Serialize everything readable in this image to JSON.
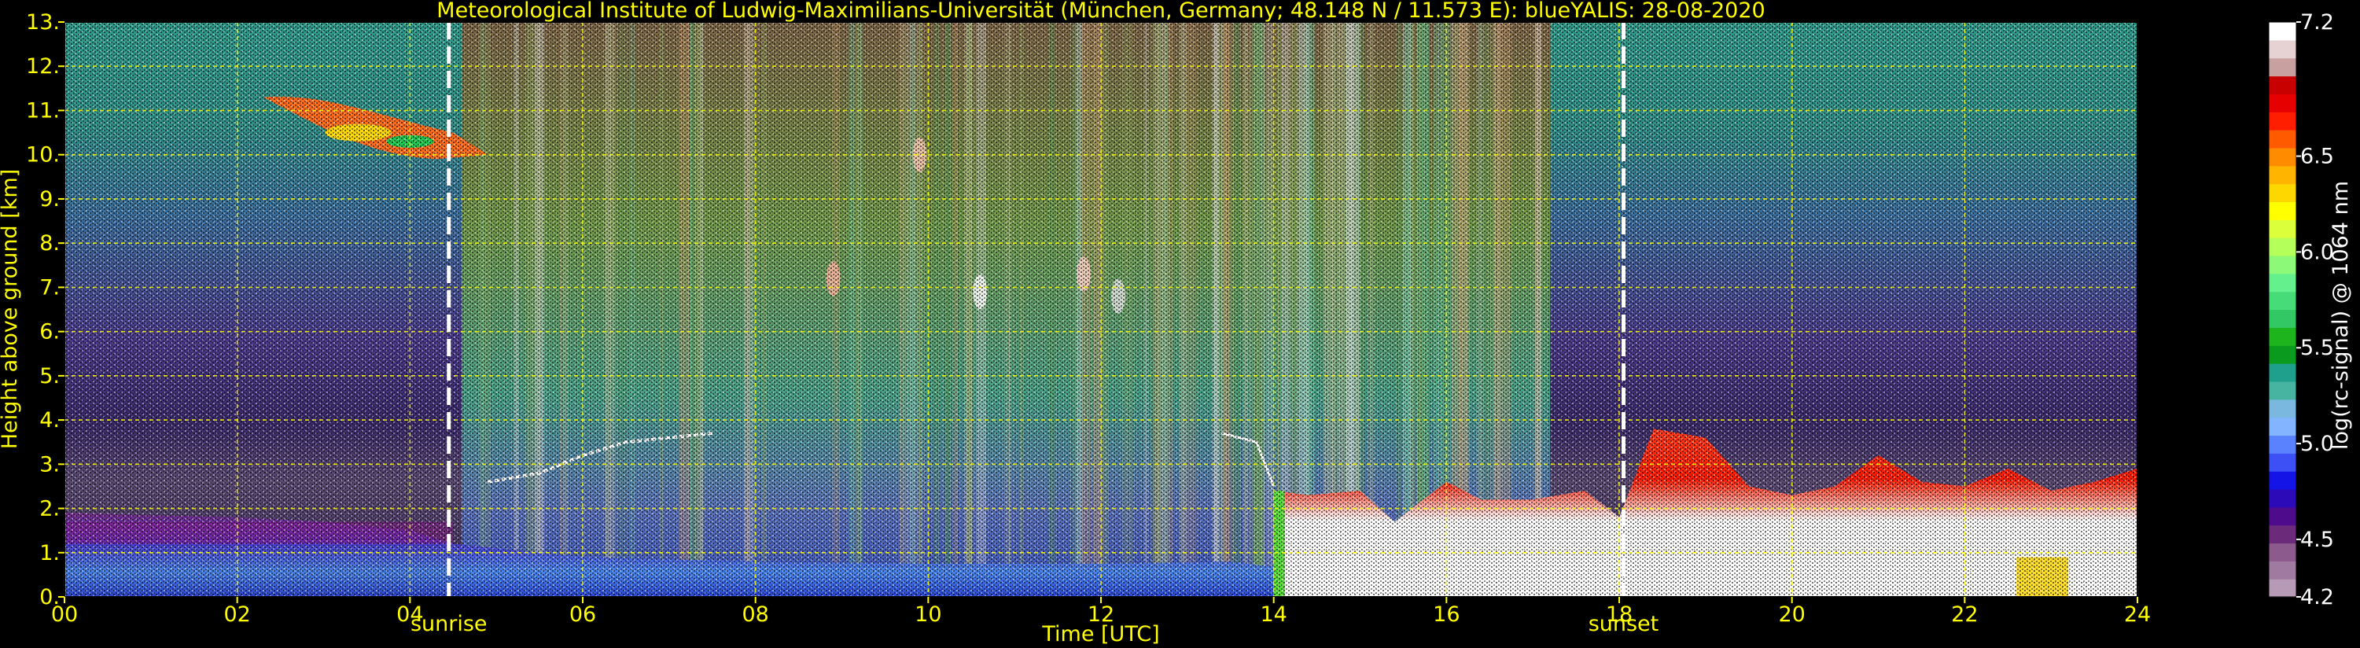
{
  "chart_data": {
    "type": "heatmap",
    "title": "Meteorological Institute of Ludwig-Maximilians-Universität (München, Germany; 48.148 N / 11.573 E):    blueYALIS: 28-08-2020",
    "xlabel": "Time [UTC]",
    "ylabel": "Height above ground [km]",
    "xlim": [
      0,
      24
    ],
    "ylim": [
      0,
      13
    ],
    "x_ticks": [
      0,
      2,
      4,
      6,
      8,
      10,
      12,
      14,
      16,
      18,
      20,
      22,
      24
    ],
    "x_tick_labels": [
      "00",
      "02",
      "04",
      "06",
      "08",
      "10",
      "12",
      "14",
      "16",
      "18",
      "20",
      "22",
      "24"
    ],
    "y_ticks": [
      0,
      1,
      2,
      3,
      4,
      5,
      6,
      7,
      8,
      9,
      10,
      11,
      12,
      13
    ],
    "y_tick_labels": [
      "0.",
      "1.",
      "2.",
      "3.",
      "4.",
      "5.",
      "6.",
      "7.",
      "8.",
      "9.",
      "10.",
      "11.",
      "12.",
      "13."
    ],
    "grid": true,
    "events": [
      {
        "label": "sunrise",
        "x": 4.45
      },
      {
        "label": "sunset",
        "x": 18.05
      }
    ],
    "colorbar": {
      "label": "log(rc-signal) @ 1064 nm",
      "range": [
        4.2,
        7.2
      ],
      "ticks": [
        4.2,
        4.5,
        5.0,
        5.5,
        6.0,
        6.5,
        7.2
      ],
      "tick_labels": [
        "4.2",
        "4.5",
        "5.0",
        "5.5",
        "6.0",
        "6.5",
        "7.2"
      ],
      "colors": [
        "#b79ab6",
        "#a07aa0",
        "#8c5a8c",
        "#6b2a7a",
        "#4e0c8c",
        "#2c0ab8",
        "#1414e6",
        "#3c50f5",
        "#5a82ff",
        "#82b4ff",
        "#7ab8e0",
        "#46b4a0",
        "#1ea08c",
        "#0a9a1e",
        "#1eb41e",
        "#32c864",
        "#46dc78",
        "#64f08c",
        "#8cfa78",
        "#b4ff5a",
        "#dcff3c",
        "#ffff00",
        "#ffd700",
        "#ffb400",
        "#ff8c00",
        "#ff5a00",
        "#ff1e00",
        "#e60000",
        "#c80000",
        "#c8a0a0",
        "#e6d2d2",
        "#ffffff"
      ]
    },
    "features": [
      {
        "name": "cirrus cloud",
        "x_range": [
          2.3,
          4.9
        ],
        "height_range": [
          9.8,
          11.4
        ]
      },
      {
        "name": "boundary layer aerosol (morning)",
        "x_range": [
          0,
          4.5
        ],
        "height_range": [
          0,
          2
        ]
      },
      {
        "name": "cloud base layer",
        "x_range": [
          14.3,
          24
        ],
        "height_range": [
          0.3,
          3.8
        ]
      }
    ]
  }
}
